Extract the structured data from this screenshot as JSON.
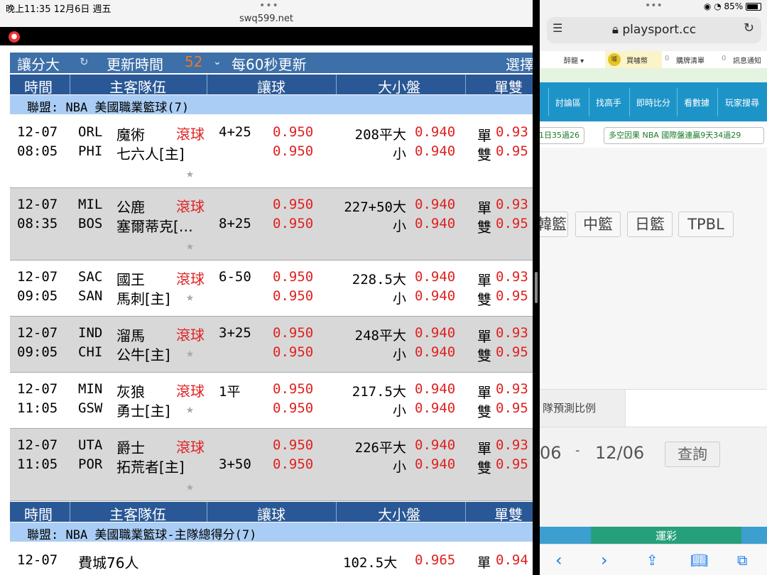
{
  "left_status": {
    "time_date": "晚上11:35  12月6日 週五",
    "dots": "•••",
    "url": "swq599.net"
  },
  "controls": {
    "handicap_big": "讓分大",
    "refresh_label": "更新時間",
    "countdown": "52",
    "interval": "每60秒更新",
    "select": "選擇"
  },
  "table_headers": {
    "time": "時間",
    "teams": "主客隊伍",
    "spread": "讓球",
    "total": "大小盤",
    "oddeven": "單雙"
  },
  "league1": "聯盟: NBA 美國職業籃球(7)",
  "games": [
    {
      "date": "12-07",
      "time": "08:05",
      "code1": "ORL",
      "team1": "魔術",
      "code2": "PHI",
      "team2": "七六人[主]",
      "live": "滾球",
      "spread_line": "4+25",
      "spread_row": 1,
      "odds1": "0.950",
      "odds2": "0.950",
      "total_line": "208平大",
      "total_odds": "0.940",
      "small": "小",
      "small_odds": "0.940",
      "odd": "單",
      "odd_odds": "0.93",
      "even": "雙",
      "even_odds": "0.95",
      "star_inline": false
    },
    {
      "date": "12-07",
      "time": "08:35",
      "code1": "MIL",
      "team1": "公鹿",
      "code2": "BOS",
      "team2": "塞爾蒂克[…",
      "live": "滾球",
      "spread_line": "8+25",
      "spread_row": 2,
      "odds1": "0.950",
      "odds2": "0.950",
      "total_line": "227+50大",
      "total_odds": "0.940",
      "small": "小",
      "small_odds": "0.940",
      "odd": "單",
      "odd_odds": "0.93",
      "even": "雙",
      "even_odds": "0.95",
      "star_inline": false
    },
    {
      "date": "12-07",
      "time": "09:05",
      "code1": "SAC",
      "team1": "國王",
      "code2": "SAN",
      "team2": "馬刺[主]",
      "live": "滾球",
      "spread_line": "6-50",
      "spread_row": 1,
      "odds1": "0.950",
      "odds2": "0.950",
      "total_line": "228.5大",
      "total_odds": "0.940",
      "small": "小",
      "small_odds": "0.940",
      "odd": "單",
      "odd_odds": "0.93",
      "even": "雙",
      "even_odds": "0.95",
      "star_inline": true
    },
    {
      "date": "12-07",
      "time": "09:05",
      "code1": "IND",
      "team1": "溜馬",
      "code2": "CHI",
      "team2": "公牛[主]",
      "live": "滾球",
      "spread_line": "3+25",
      "spread_row": 1,
      "odds1": "0.950",
      "odds2": "0.950",
      "total_line": "248平大",
      "total_odds": "0.940",
      "small": "小",
      "small_odds": "0.940",
      "odd": "單",
      "odd_odds": "0.93",
      "even": "雙",
      "even_odds": "0.95",
      "star_inline": true
    },
    {
      "date": "12-07",
      "time": "11:05",
      "code1": "MIN",
      "team1": "灰狼",
      "code2": "GSW",
      "team2": "勇士[主]",
      "live": "滾球",
      "spread_line": "1平",
      "spread_row": 1,
      "odds1": "0.950",
      "odds2": "0.950",
      "total_line": "217.5大",
      "total_odds": "0.940",
      "small": "小",
      "small_odds": "0.940",
      "odd": "單",
      "odd_odds": "0.93",
      "even": "雙",
      "even_odds": "0.95",
      "star_inline": true
    },
    {
      "date": "12-07",
      "time": "11:05",
      "code1": "UTA",
      "team1": "爵士",
      "code2": "POR",
      "team2": "拓荒者[主]",
      "live": "滾球",
      "spread_line": "3+50",
      "spread_row": 2,
      "odds1": "0.950",
      "odds2": "0.950",
      "total_line": "226平大",
      "total_odds": "0.940",
      "small": "小",
      "small_odds": "0.940",
      "odd": "單",
      "odd_odds": "0.93",
      "even": "雙",
      "even_odds": "0.95",
      "star_inline": false
    }
  ],
  "star": "★",
  "league2": "聯盟: NBA 美國職業籃球-主隊總得分(7)",
  "partial_game": {
    "date": "12-07",
    "team": "費城76人",
    "total_line": "102.5大",
    "total_odds": "0.965",
    "odd": "單",
    "odd_odds": "0.94"
  },
  "right_status": {
    "dots": "•••",
    "battery": "85%"
  },
  "right_url": "playsport.cc",
  "right_subbar": {
    "drunk": "醉龍 ▾",
    "buy_coin": "買噱幣",
    "cart": "購牌清單",
    "notice": "訊息通知",
    "zero": "0"
  },
  "right_nav": [
    "討論區",
    "找高手",
    "即時比分",
    "看數據",
    "玩家搜尋"
  ],
  "marquee": [
    "1日35過26",
    "多空因果  NBA  國際盤連贏9天34過29"
  ],
  "league_buttons": [
    "韓籃",
    "中籃",
    "日籃",
    "TPBL"
  ],
  "predict_tab": "隊預測比例",
  "dates": {
    "from": "06",
    "dash": "-",
    "to": "12/06",
    "query": "查詢"
  },
  "lottery": "運彩",
  "colors": {
    "header_blue": "#2a5896",
    "league_band": "#aacdf5",
    "odds_red": "#e02020",
    "nav_blue": "#1d94c8",
    "lottery_green": "#26a07a"
  }
}
